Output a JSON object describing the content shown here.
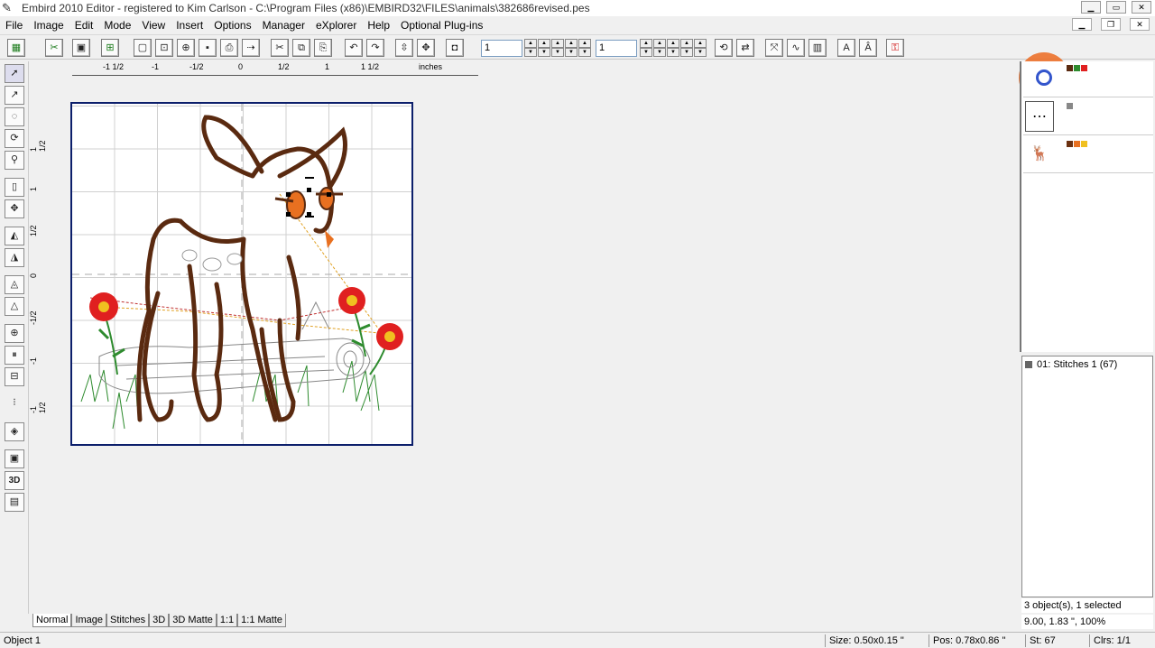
{
  "window": {
    "title": "Embird 2010 Editor - registered to Kim Carlson - C:\\Program Files (x86)\\EMBIRD32\\FILES\\animals\\382686revised.pes"
  },
  "menu": [
    "File",
    "Image",
    "Edit",
    "Mode",
    "View",
    "Insert",
    "Options",
    "Manager",
    "eXplorer",
    "Help",
    "Optional Plug-ins"
  ],
  "toolbar": {
    "combo1_value": "1",
    "combo2_value": "1"
  },
  "ruler": {
    "h_ticks": [
      "-1 1/2",
      "-1",
      "-1/2",
      "0",
      "1/2",
      "1",
      "1 1/2"
    ],
    "unit": "inches",
    "v_ticks": [
      "1 1/2",
      "1",
      "1/2",
      "0",
      "-1/2",
      "-1",
      "-1 1/2"
    ]
  },
  "objects_panel": {
    "rows": [
      {
        "swatches": [
          "#5a2a10",
          "#2e8b2e",
          "#e02020"
        ]
      },
      {
        "swatches": [
          "#888888"
        ]
      },
      {
        "swatches": [
          "#6b3010",
          "#e87020",
          "#f0c020"
        ]
      }
    ]
  },
  "stitch_panel": {
    "item": "01:  Stitches 1 (67)"
  },
  "info": {
    "objects": "3 object(s), 1 selected",
    "position": "9.00, 1.83 \", 100%"
  },
  "tabs": [
    "Normal",
    "Image",
    "Stitches",
    "3D",
    "3D Matte",
    "1:1",
    "1:1 Matte"
  ],
  "status": {
    "object": "Object 1",
    "size": "Size: 0.50x0.15 \"",
    "pos": "Pos: 0.78x0.86 \"",
    "st": "St: 67",
    "clrs": "Clrs: 1/1"
  },
  "colors": {
    "hoop_border": "#0c1f6b",
    "deer_outline": "#5a2a10",
    "flower_red": "#e02020",
    "flower_yellow": "#f0c020",
    "leaf_green": "#2e8b2e"
  }
}
